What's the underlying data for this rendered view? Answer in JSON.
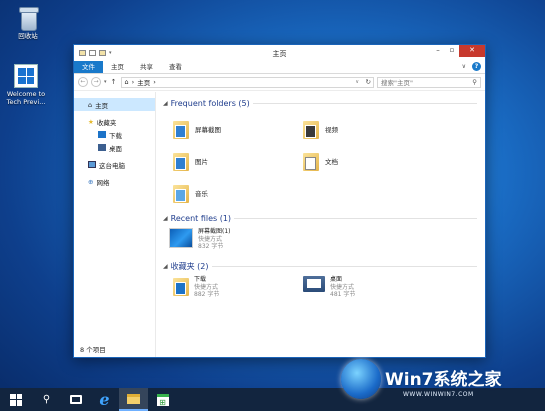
{
  "desktop": {
    "icons": [
      {
        "label": "回收站",
        "icon": "recycle-bin-icon"
      },
      {
        "label": "Welcome to Tech Previ...",
        "icon": "windows-tile-icon"
      }
    ]
  },
  "window": {
    "title": "主页",
    "ribbon_tabs": [
      "文件",
      "主页",
      "共享",
      "查看"
    ],
    "address": {
      "home_label": "主页",
      "separator": "›"
    },
    "search_placeholder": "搜索\"主页\"",
    "nav_items": [
      "主页",
      "收藏夹",
      "下载",
      "桌面",
      "这台电脑",
      "网络"
    ],
    "status": "8 个项目"
  },
  "sections": {
    "frequent": {
      "title": "Frequent folders (5)",
      "items": [
        "屏幕截图",
        "视频",
        "图片",
        "文档",
        "音乐"
      ]
    },
    "recent": {
      "title": "Recent files (1)",
      "items": [
        {
          "name": "屏幕截图(1)",
          "type": "快捷方式",
          "size": "832 字节"
        }
      ]
    },
    "favorites": {
      "title": "收藏夹 (2)",
      "items": [
        {
          "name": "下载",
          "type": "快捷方式",
          "size": "882 字节"
        },
        {
          "name": "桌面",
          "type": "快捷方式",
          "size": "481 字节"
        }
      ]
    }
  },
  "watermark": {
    "brand": "Win7系统之家",
    "url": "WWW.WINWIN7.COM"
  },
  "colors": {
    "accent": "#1979ca",
    "close": "#c7392d",
    "section_heading": "#1e3c8c",
    "taskbar": "#12253f"
  }
}
